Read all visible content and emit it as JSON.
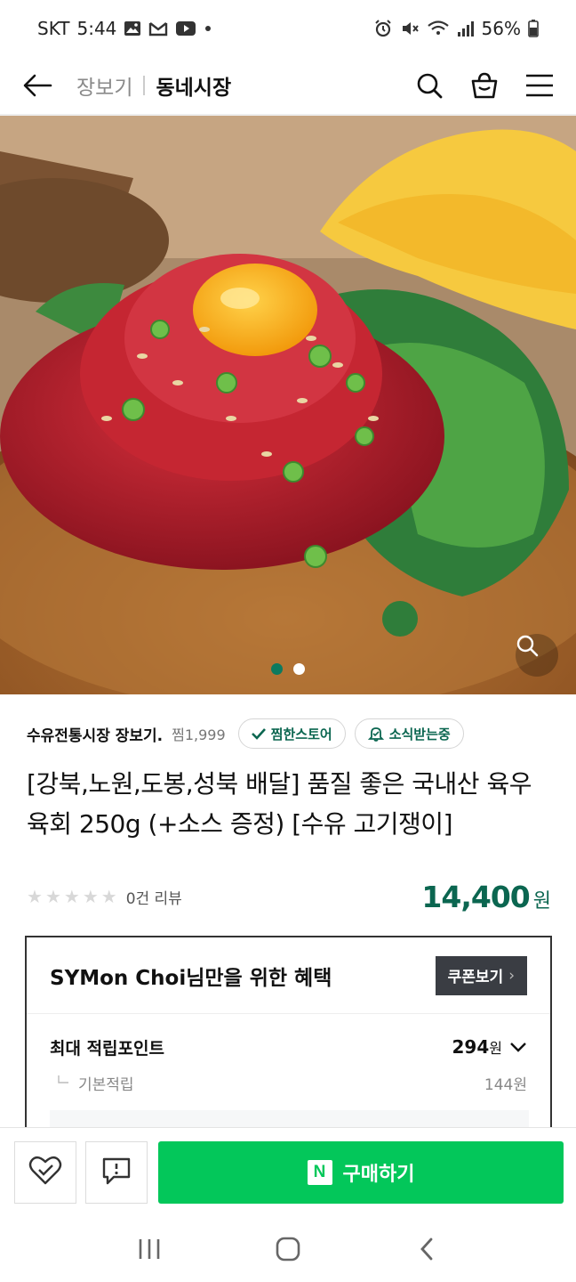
{
  "status_bar": {
    "carrier": "SKT",
    "time": "5:44",
    "battery": "56%"
  },
  "header": {
    "crumb_parent": "장보기",
    "crumb_current": "동네시장"
  },
  "gallery": {
    "image_count": 2,
    "active_index": 0
  },
  "store": {
    "name": "수유전통시장 장보기.",
    "likes": "찜1,999",
    "follow_label": "찜한스토어",
    "notify_label": "소식받는중"
  },
  "product": {
    "title": "[강북,노원,도봉,성북 배달] 품질 좋은 국내산 육우 육회 250g (+소스 증정) [수유 고기쟁이]",
    "rating_stars": 0,
    "review_text": "0건 리뷰",
    "price": "14,400",
    "price_unit": "원"
  },
  "benefit": {
    "title": "SYMon Choi님만을 위한 혜택",
    "coupon_label": "쿠폰보기",
    "coupon_chevron": "›",
    "max_point_label": "최대 적립포인트",
    "max_point_value": "294",
    "max_point_unit": "원",
    "base_label": "기본적립",
    "base_value": "144원"
  },
  "actions": {
    "buy_label": "구매하기",
    "buy_logo": "N"
  },
  "colors": {
    "accent_green": "#03c75a",
    "price_green": "#0b6650",
    "coupon_bg": "#3a3d43"
  }
}
